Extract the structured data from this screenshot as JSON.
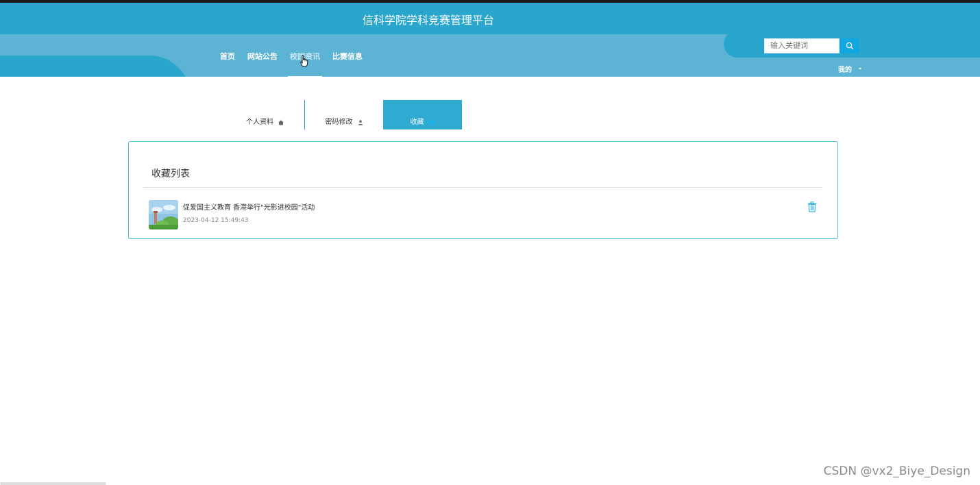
{
  "header": {
    "title": "信科学院学科竞赛管理平台",
    "nav": [
      {
        "label": "首页",
        "active": false
      },
      {
        "label": "网站公告",
        "active": false
      },
      {
        "label": "校园资讯",
        "active": true
      },
      {
        "label": "比赛信息",
        "active": false
      }
    ],
    "search_placeholder": "输入关键词",
    "my_menu_label": "我的"
  },
  "tabs": [
    {
      "label": "个人资料",
      "icon": "home-icon",
      "active": false
    },
    {
      "label": "密码修改",
      "icon": "user-icon",
      "active": false
    },
    {
      "label": "收藏",
      "icon": "heart-icon",
      "active": true
    }
  ],
  "favorites": {
    "title": "收藏列表",
    "items": [
      {
        "title": "促爱国主义教育 香港举行\"光影进校园\"活动",
        "time": "2023-04-12 15:49:43",
        "icon": "trash-icon"
      }
    ]
  },
  "watermark": "CSDN @vx2_Biye_Design",
  "colors": {
    "primary": "#2aa5cb",
    "header_light": "#5cb3d3",
    "search_button": "#12a7e0",
    "panel_border": "#4fc0dd"
  }
}
